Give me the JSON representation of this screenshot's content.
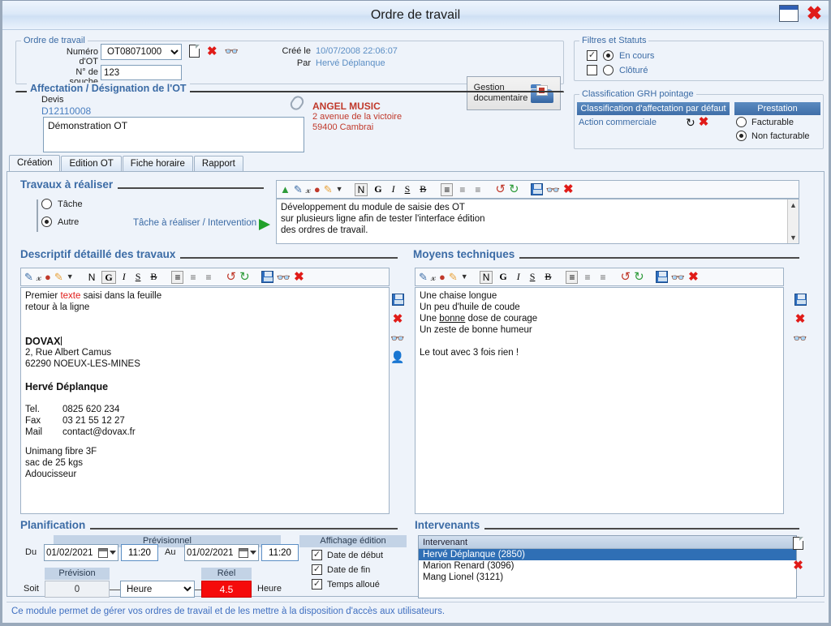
{
  "window": {
    "title": "Ordre de travail",
    "restore_icon": "restore-icon",
    "close_icon": "close-icon"
  },
  "ordre_de_travail": {
    "legend": "Ordre de travail",
    "numero_label": "Numéro d'OT",
    "numero_value": "OT08071000",
    "souche_label": "N° de souche",
    "souche_value": "123",
    "icons": [
      "new-document-icon",
      "delete-icon",
      "search-binoculars-icon"
    ],
    "cree_le_label": "Créé le",
    "cree_le_value": "10/07/2008 22:06:07",
    "par_label": "Par",
    "par_value": "Hervé Déplanque",
    "gestion_button_line1": "Gestion",
    "gestion_button_line2": "documentaire"
  },
  "affectation": {
    "legend": "Affectation / Désignation de l'OT",
    "devis_label": "Devis",
    "devis_value": "D12110008",
    "designation_value": "Démonstration OT",
    "client_name": "ANGEL MUSIC",
    "client_address": "2 avenue de la victoire",
    "client_city": "59400 Cambrai"
  },
  "filtres_statuts": {
    "legend": "Filtres et Statuts",
    "options": [
      {
        "label": "En cours",
        "checked": true,
        "radio": true
      },
      {
        "label": "Clôturé",
        "checked": false,
        "radio": false
      }
    ]
  },
  "classification": {
    "legend": "Classification GRH pointage",
    "header_left": "Classification d'affectation par défaut",
    "header_right": "Prestation",
    "action_label": "Action commerciale",
    "refresh_icon": "refresh-icon",
    "delete_icon": "delete-icon",
    "prestation_options": [
      {
        "label": "Facturable",
        "selected": false
      },
      {
        "label": "Non facturable",
        "selected": true
      }
    ]
  },
  "tabs": [
    {
      "label": "Création",
      "active": true
    },
    {
      "label": "Edition OT",
      "active": false
    },
    {
      "label": "Fiche horaire",
      "active": false
    },
    {
      "label": "Rapport",
      "active": false
    }
  ],
  "travaux": {
    "title": "Travaux à réaliser",
    "radio_tache": "Tâche",
    "radio_autre": "Autre",
    "tache_link": "Tâche à réaliser / Intervention",
    "toolbar": [
      "format-icon",
      "brush-icon",
      "font-size-icon",
      "palette-icon",
      "highlighter-icon",
      "dropdown-caret-icon",
      "normal-icon",
      "bold-icon",
      "italic-icon",
      "underline-icon",
      "strikethrough-icon",
      "align-left-icon",
      "align-center-icon",
      "align-right-icon",
      "undo-icon",
      "redo-icon",
      "save-icon",
      "search-binoculars-icon",
      "delete-icon"
    ],
    "text_lines": [
      "Développement du module de saisie des OT",
      "sur plusieurs ligne afin de tester l'interface édition",
      "des ordres de travail."
    ]
  },
  "descriptif": {
    "title": "Descriptif détaillé des travaux",
    "toolbar": [
      "brush-icon",
      "font-size-icon",
      "palette-icon",
      "highlighter-icon",
      "dropdown-caret-icon",
      "normal-icon",
      "bold-icon",
      "italic-icon",
      "underline-icon",
      "strikethrough-icon",
      "align-left-icon",
      "align-center-icon",
      "align-right-icon",
      "undo-icon",
      "redo-icon",
      "save-icon",
      "search-binoculars-icon",
      "delete-icon"
    ],
    "side_icons": [
      "save-icon",
      "delete-icon",
      "search-binoculars-icon",
      "contact-icon"
    ],
    "content": {
      "line1_a": "Premier ",
      "line1_red": "texte",
      "line1_b": " saisi dans la feuille",
      "line2": "retour à la ligne",
      "company": "DOVAX",
      "address1": "2, Rue Albert Camus",
      "address2": "62290 NOEUX-LES-MINES",
      "person": "Hervé Déplanque",
      "tel_label": "Tel.",
      "tel_value": "0825 620 234",
      "fax_label": "Fax",
      "fax_value": "03 21 55 12 27",
      "mail_label": "Mail",
      "mail_value": "contact@dovax.fr",
      "note1": "Unimang fibre 3F",
      "note2": "sac de 25 kgs",
      "note3": "Adoucisseur"
    }
  },
  "moyens": {
    "title": "Moyens techniques",
    "toolbar": [
      "brush-icon",
      "font-size-icon",
      "palette-icon",
      "highlighter-icon",
      "dropdown-caret-icon",
      "normal-icon",
      "bold-icon",
      "italic-icon",
      "underline-icon",
      "strikethrough-icon",
      "align-left-icon",
      "align-center-icon",
      "align-right-icon",
      "undo-icon",
      "redo-icon",
      "save-icon",
      "search-binoculars-icon",
      "delete-icon"
    ],
    "side_icons": [
      "save-icon",
      "delete-icon",
      "search-binoculars-icon"
    ],
    "lines": {
      "l1": "Une chaise longue",
      "l2": "Un peu d'huile de coude",
      "l3_a": "Une ",
      "l3_u": "bonne",
      "l3_b": " dose de courage",
      "l4": "Un zeste de bonne humeur",
      "l5": "Le tout avec 3 fois rien !"
    }
  },
  "planification": {
    "title": "Planification",
    "previsionnel_header": "Prévisionnel",
    "du_label": "Du",
    "du_date": "01/02/2021",
    "du_time": "11:20",
    "au_label": "Au",
    "au_date": "01/02/2021",
    "au_time": "11:20",
    "soit_label": "Soit",
    "prevision_header": "Prévision",
    "prevision_value": "0",
    "unit_value": "Heure",
    "reel_header": "Réel",
    "reel_value": "4.5",
    "reel_unit": "Heure",
    "affichage_header": "Affichage édition",
    "affichage_options": [
      {
        "label": "Date de début",
        "checked": true
      },
      {
        "label": "Date de fin",
        "checked": true
      },
      {
        "label": "Temps alloué",
        "checked": true
      }
    ]
  },
  "intervenants": {
    "title": "Intervenants",
    "column_header": "Intervenant",
    "rows": [
      {
        "label": "Hervé Déplanque (2850)",
        "selected": true
      },
      {
        "label": "Marion Renard (3096)",
        "selected": false
      },
      {
        "label": "Mang Lionel (3121)",
        "selected": false
      }
    ],
    "side_icons": [
      "new-document-icon",
      "delete-icon"
    ]
  },
  "statusbar": {
    "text": "Ce module permet de gérer vos ordres de travail et de les mettre à la disposition d'accès aux utilisateurs."
  },
  "colors": {
    "accent_blue": "#3b6ba5",
    "red": "#e01b18",
    "client_red": "#c0392b",
    "selection_blue": "#2f6fb5",
    "real_red_bg": "#f50b0b",
    "green_arrow": "#22a12a"
  }
}
